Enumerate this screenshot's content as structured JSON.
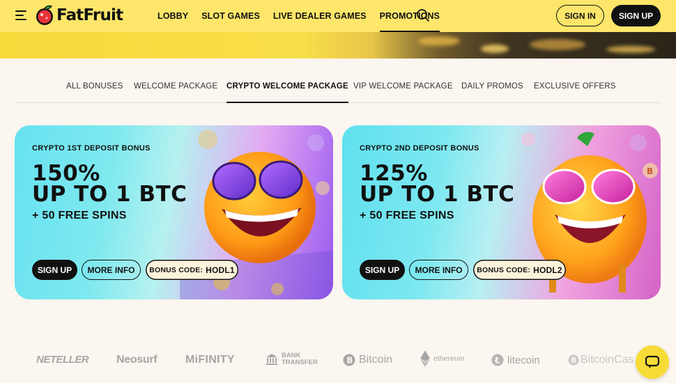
{
  "header": {
    "logo_text": "FatFruit",
    "nav": [
      "LOBBY",
      "SLOT GAMES",
      "LIVE DEALER GAMES",
      "PROMOTIONS"
    ],
    "active_nav": "PROMOTIONS",
    "sign_in": "SIGN IN",
    "sign_up": "SIGN UP"
  },
  "tabs": [
    "ALL BONUSES",
    "WELCOME PACKAGE",
    "CRYPTO WELCOME PACKAGE",
    "VIP WELCOME PACKAGE",
    "DAILY PROMOS",
    "EXCLUSIVE OFFERS"
  ],
  "active_tab": "CRYPTO WELCOME PACKAGE",
  "cards": [
    {
      "kicker": "CRYPTO 1ST DEPOSIT BONUS",
      "headline_line1": "150%",
      "headline_line2": "UP TO 1 BTC",
      "sub": "+ 50 FREE SPINS",
      "sign_up": "SIGN UP",
      "more_info": "MORE INFO",
      "code_label": "BONUS CODE:",
      "code": "HODL1"
    },
    {
      "kicker": "CRYPTO 2ND DEPOSIT BONUS",
      "headline_line1": "125%",
      "headline_line2": "UP TO 1 BTC",
      "sub": "+ 50 FREE SPINS",
      "sign_up": "SIGN UP",
      "more_info": "MORE INFO",
      "code_label": "BONUS CODE:",
      "code": "HODL2"
    }
  ],
  "payments": [
    "NETELLER",
    "Neosurf",
    "MiFINITY",
    "BANK",
    "TRANSFER",
    "Bitcoin",
    "ethereum",
    "litecoin",
    "BitcoinCas"
  ],
  "colors": {
    "header_bg": "#fde66a",
    "page_bg": "#fbf6ef",
    "primary_dark": "#111111",
    "chat_button": "#f7dc38"
  }
}
